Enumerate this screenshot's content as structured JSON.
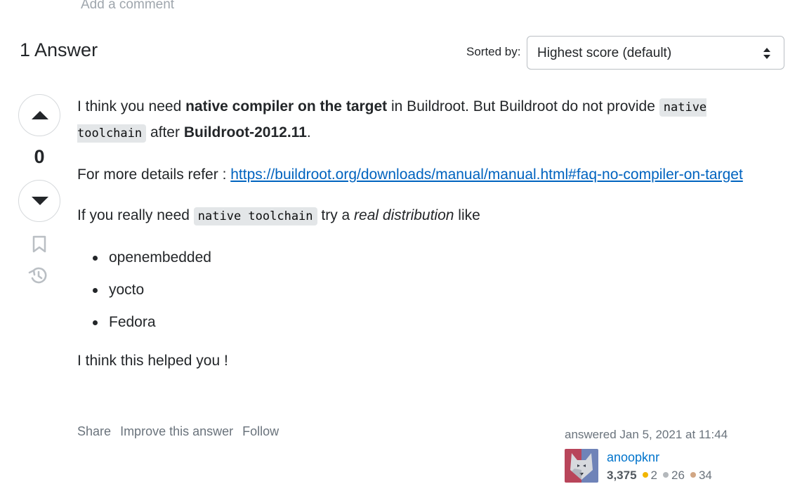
{
  "comment_link": "Add a comment",
  "answers_header": "1 Answer",
  "sort": {
    "label": "Sorted by:",
    "value": "Highest score (default)"
  },
  "vote": {
    "count": "0"
  },
  "post": {
    "p1": {
      "t1": "I think you need ",
      "b1": "native compiler on the target",
      "t2": " in Buildroot. But Buildroot do not provide ",
      "code1": "native toolchain",
      "t3": " after ",
      "b2": "Buildroot-2012.11",
      "t4": "."
    },
    "p2": {
      "t1": "For more details refer : ",
      "link": "https://buildroot.org/downloads/manual/manual.html#faq-no-compiler-on-target"
    },
    "p3": {
      "t1": "If you really need ",
      "code1": "native toolchain",
      "t2": " try a ",
      "i1": "real distribution",
      "t3": " like"
    },
    "list": [
      "openembedded",
      "yocto",
      "Fedora"
    ],
    "p4": "I think this helped you !"
  },
  "menu": {
    "share": "Share",
    "improve": "Improve this answer",
    "follow": "Follow"
  },
  "signature": {
    "action_time": "answered Jan 5, 2021 at 11:44",
    "user": "anoopknr",
    "reputation": "3,375",
    "gold": "2",
    "silver": "26",
    "bronze": "34"
  }
}
